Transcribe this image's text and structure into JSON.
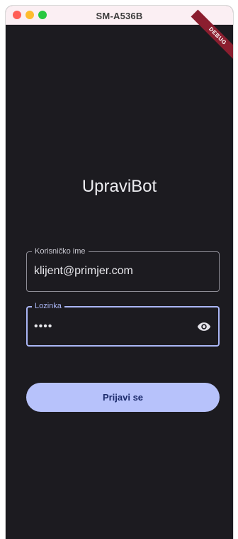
{
  "window": {
    "title": "SM-A536B",
    "debug_banner": "DEBUG"
  },
  "app": {
    "title": "UpraviBot"
  },
  "username": {
    "label": "Korisničko ime",
    "value": "klijent@primjer.com"
  },
  "password": {
    "label": "Lozinka",
    "value": "••••",
    "toggle_icon": "eye-icon"
  },
  "login": {
    "label": "Prijavi se"
  },
  "colors": {
    "background": "#1c1b20",
    "accent": "#aab6f5",
    "button": "#b7c2fb",
    "button_text": "#1b2a6b",
    "debug": "#8b1e2f"
  }
}
